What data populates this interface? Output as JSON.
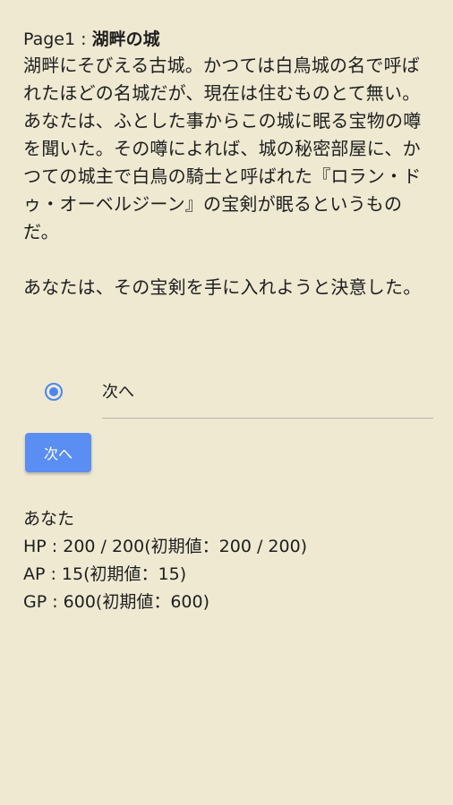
{
  "page": {
    "label": "Page1 : ",
    "title": "湖畔の城"
  },
  "story": {
    "paragraphs": [
      "湖畔にそびえる古城。かつては白鳥城の名で呼ばれたほどの名城だが、現在は住むものとて無い。",
      "あなたは、ふとした事からこの城に眠る宝物の噂を聞いた。その噂によれば、城の秘密部屋に、かつての城主で白鳥の騎士と呼ばれた『ロラン・ドゥ・オーベルジーン』の宝剣が眠るというものだ。",
      "あなたは、その宝剣を手に入れようと決意した。"
    ]
  },
  "choice": {
    "option_label": "次へ",
    "selected": true
  },
  "button": {
    "next_label": "次へ"
  },
  "status": {
    "heading": "あなた",
    "hp": "HP : 200 / 200(初期値：200 / 200)",
    "ap": "AP : 15(初期値：15)",
    "gp": "GP : 600(初期値：600)"
  },
  "colors": {
    "background": "#efe9d2",
    "accent": "#5b8ef2"
  }
}
